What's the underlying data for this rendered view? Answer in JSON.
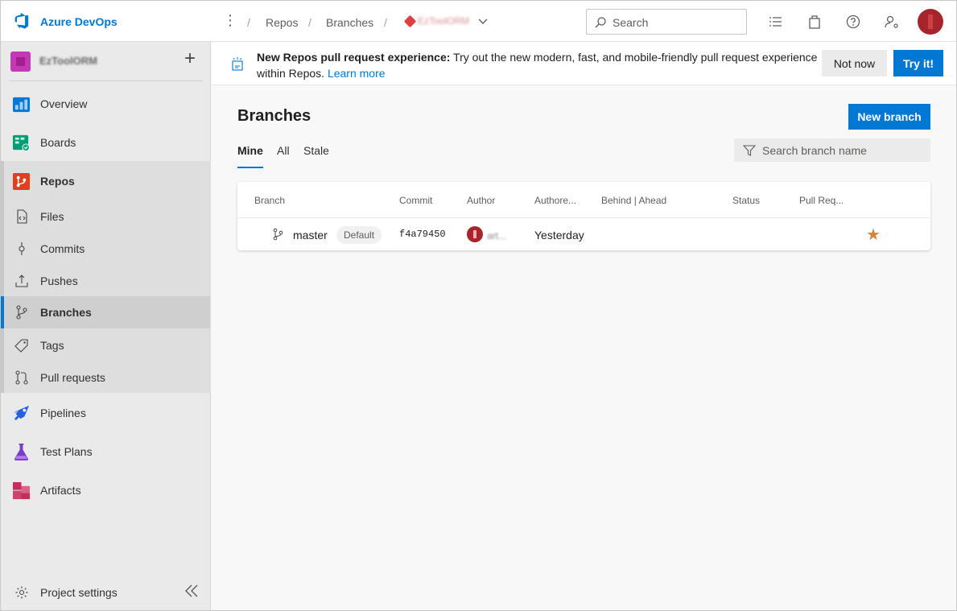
{
  "app": {
    "brand": "Azure DevOps",
    "brand_color": "#0078d4"
  },
  "breadcrumbs": [
    "Repos",
    "Branches"
  ],
  "repo_crumb": "EzToolORM",
  "search": {
    "placeholder": "Search"
  },
  "project": {
    "name": "EzToolORM"
  },
  "nav": {
    "overview": "Overview",
    "boards": "Boards",
    "repos": "Repos",
    "files": "Files",
    "commits": "Commits",
    "pushes": "Pushes",
    "branches": "Branches",
    "tags": "Tags",
    "pull_requests": "Pull requests",
    "pipelines": "Pipelines",
    "test_plans": "Test Plans",
    "artifacts": "Artifacts",
    "project_settings": "Project settings"
  },
  "banner": {
    "title": "New Repos pull request experience:",
    "body": " Try out the new modern, fast, and mobile-friendly pull request experience within Repos. ",
    "link": "Learn more",
    "not_now": "Not now",
    "try_it": "Try it!"
  },
  "main": {
    "title": "Branches",
    "new_branch": "New branch",
    "tabs": [
      "Mine",
      "All",
      "Stale"
    ],
    "active_tab": "Mine",
    "filter_placeholder": "Search branch name"
  },
  "table": {
    "headers": [
      "Branch",
      "Commit",
      "Author",
      "Authore...",
      "Behind | Ahead",
      "Status",
      "Pull Req..."
    ],
    "rows": [
      {
        "branch": "master",
        "badge": "Default",
        "commit": "f4a79450",
        "author": "art...",
        "authored": "Yesterday",
        "favorite": true
      }
    ]
  }
}
